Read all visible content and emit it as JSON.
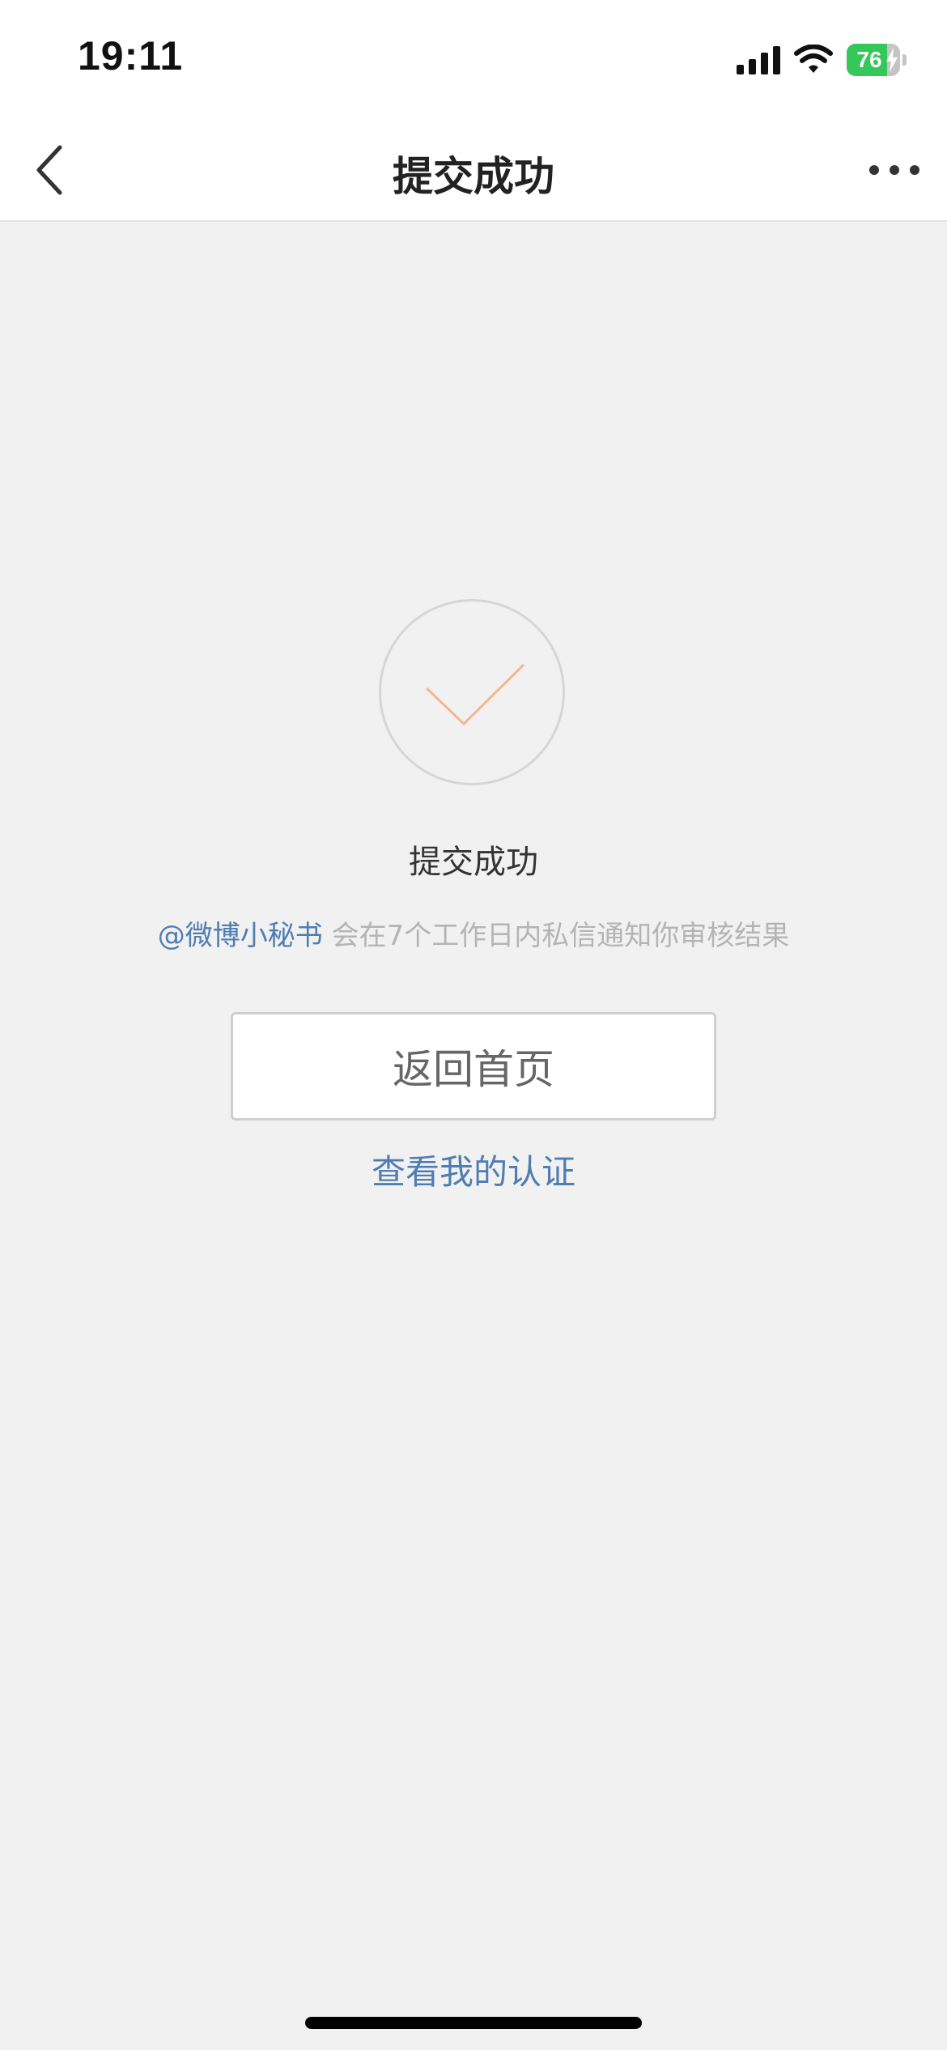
{
  "status_bar": {
    "time": "19:11",
    "battery_level": "76",
    "battery_charging": true,
    "battery_color": "#34c759"
  },
  "nav": {
    "title": "提交成功",
    "back_icon": "chevron-left-icon",
    "more_icon": "more-dots-icon"
  },
  "content": {
    "success_icon": "check-icon",
    "check_color": "#f5b58e",
    "success_title": "提交成功",
    "notice_mention": "@微博小秘书",
    "notice_text": " 会在7个工作日内私信通知你审核结果",
    "home_button_label": "返回首页",
    "view_cert_label": "查看我的认证",
    "link_color": "#4e7db1"
  }
}
